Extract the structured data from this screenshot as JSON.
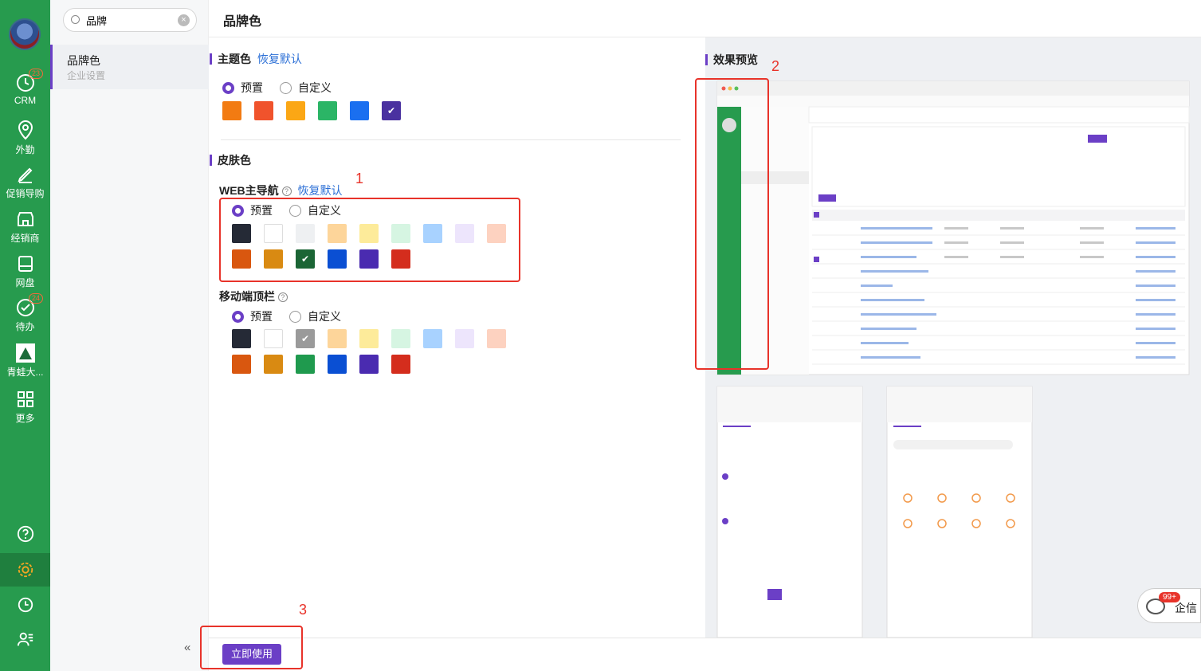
{
  "rail": {
    "items": [
      {
        "label": "CRM",
        "badge": "23"
      },
      {
        "label": "外勤"
      },
      {
        "label": "促销导购"
      },
      {
        "label": "经销商"
      },
      {
        "label": "网盘"
      },
      {
        "label": "待办",
        "badge": "24"
      },
      {
        "label": "青蛙大..."
      },
      {
        "label": "更多"
      }
    ]
  },
  "subnav": {
    "search_value": "品牌",
    "item_title": "品牌色",
    "item_subtitle": "企业设置",
    "collapse": "«"
  },
  "page": {
    "title": "品牌色"
  },
  "theme": {
    "title": "主题色",
    "restore": "恢复默认",
    "opt_preset": "预置",
    "opt_custom": "自定义",
    "selected": "preset",
    "swatches": [
      "#f27b12",
      "#f0532c",
      "#fba715",
      "#2bb566",
      "#1a6ff0",
      "#4a31a0"
    ],
    "checked_index": 5
  },
  "skin": {
    "title": "皮肤色",
    "web": {
      "label": "WEB主导航",
      "restore": "恢复默认",
      "opt_preset": "预置",
      "opt_custom": "自定义",
      "row1": [
        "#252a36",
        "#ffffff",
        "#eef0f2",
        "#fdd59a",
        "#fdeb9a",
        "#d6f5e2",
        "#a8d2ff",
        "#ede5fc",
        "#fdd2c0"
      ],
      "row2": [
        "#d9570f",
        "#d98a12",
        "#1b6535",
        "#0a4fd3",
        "#4a2bb0",
        "#d42d1d"
      ],
      "checked_row2_index": 2
    },
    "mobile": {
      "label": "移动端顶栏",
      "opt_preset": "预置",
      "opt_custom": "自定义",
      "row1": [
        "#252a36",
        "#ffffff",
        "#9a9a9a",
        "#fdd59a",
        "#fdeb9a",
        "#d6f5e2",
        "#a8d2ff",
        "#ede5fc",
        "#fdd2c0"
      ],
      "row2": [
        "#d9570f",
        "#d98a12",
        "#1f9a4e",
        "#0a4fd3",
        "#4a2bb0",
        "#d42d1d"
      ],
      "checked_row1_index": 2
    }
  },
  "preview": {
    "title": "效果预览"
  },
  "annotations": [
    "1",
    "2",
    "3"
  ],
  "footer": {
    "apply_button": "立即使用"
  },
  "chat": {
    "badge": "99+",
    "label": "企信"
  }
}
